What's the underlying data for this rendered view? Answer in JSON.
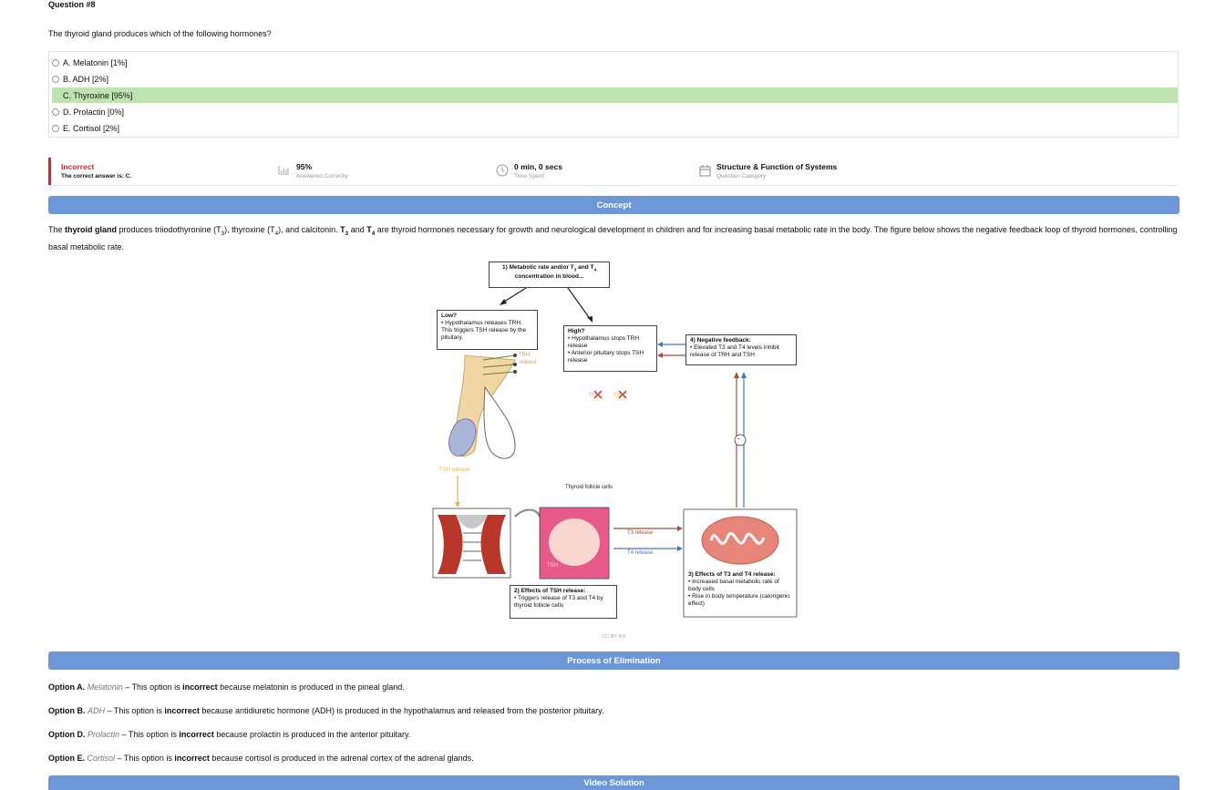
{
  "question": {
    "number": "Question #8",
    "text": "The thyroid gland produces which of the following hormones?",
    "options": [
      {
        "label": "A. Melatonin [1%]",
        "correct": false
      },
      {
        "label": "B. ADH [2%]",
        "correct": false
      },
      {
        "label": "C. Thyroxine [95%]",
        "correct": true
      },
      {
        "label": "D. Prolactin [0%]",
        "correct": false
      },
      {
        "label": "E. Cortisol [2%]",
        "correct": false
      }
    ]
  },
  "result": {
    "status": "Incorrect",
    "correct_answer": "The correct answer is: C.",
    "percent": "95%",
    "percent_label": "Answered Correctly",
    "time": "0 min, 0 secs",
    "time_label": "Time Spent",
    "category": "Structure & Function of Systems",
    "category_label": "Question Category",
    "status_color": "#d9262a"
  },
  "concept": {
    "header": "Concept",
    "p1": "The ",
    "thyroid": "thyroid gland",
    "p2": " produces triiodothyronine (T",
    "s3": "3",
    "p3": "), thyroxine (T",
    "s4": "4",
    "p4": "), and calcitonin. ",
    "t3": "T",
    "t3s": "3",
    "and": " and ",
    "t4": "T",
    "t4s": "4",
    "p5": " are thyroid hormones necessary for growth and neurological development in children and for increasing basal metabolic rate in the body. The figure below shows the negative feedback loop of thyroid hormones, controlling basal metabolic rate."
  },
  "figure": {
    "box1a": "1) Metabolic rate and/or T",
    "box1s3": "3",
    "box1b": " and T",
    "box1s4": "4",
    "box1c": "concentration in blood...",
    "low_title": "Low?",
    "low_text": "• Hypothalamus releases TRH. This triggers TSH release by the pituitary.",
    "high_title": "High?",
    "high_text1": "• Hypothalamus stops TRH release",
    "high_text2": "• Anterior pituitary stops TSH release",
    "neg_title": "4) Negative feedback:",
    "neg_text": "• Elevated T3 and T4 levels inhibit release of TRH and TSH",
    "trh": "TRH release",
    "tsh": "TSH release",
    "tsh_small": "TSH",
    "follicle": "Thyroid follicle cells",
    "t3_release": "T3 release",
    "t4_release": "T4 release",
    "box2_title": "2) Effects of TSH release:",
    "box2_text": "• Triggers release of T3 and T4 by thyroid follicle cells",
    "box3_title": "3) Effects of T3 and T4 release:",
    "box3_text1": "• Increased basal metabolic rate of body cells",
    "box3_text2": "• Rise in body temperature (calorigenic effect)",
    "minus": "−",
    "trh_x": "TRH",
    "tsh_x": "TSH",
    "credit": "CC BY 4.0"
  },
  "elimination": {
    "header": "Process of Elimination",
    "items": [
      {
        "opt": "Option A.",
        "name": "Melatonin",
        "pre": " – This option is ",
        "bold": "incorrect",
        "post": " because melatonin is produced in the pineal gland."
      },
      {
        "opt": "Option B.",
        "name": "ADH",
        "pre": " – This option is ",
        "bold": "incorrect",
        "post": " because antidiuretic hormone (ADH) is produced in the hypothalamus and released from the posterior pituitary."
      },
      {
        "opt": "Option D.",
        "name": "Prolactin",
        "pre": " – This option is ",
        "bold": "incorrect",
        "post": " because prolactin is produced in the anterior pituitary."
      },
      {
        "opt": "Option E.",
        "name": "Cortisol",
        "pre": " – This option is ",
        "bold": "incorrect",
        "post": " because cortisol is produced in the adrenal cortex of the adrenal glands."
      }
    ]
  },
  "video": {
    "header": "Video Solution"
  },
  "colors": {
    "accent": "#6d97d6",
    "correct_bg": "#bfe3b1"
  }
}
